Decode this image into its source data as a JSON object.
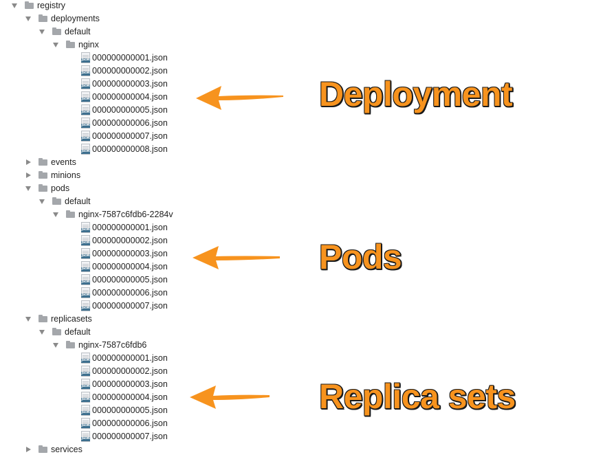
{
  "tree": [
    {
      "depth": 0,
      "type": "folder",
      "expanded": true,
      "label": "registry"
    },
    {
      "depth": 1,
      "type": "folder",
      "expanded": true,
      "label": "deployments"
    },
    {
      "depth": 2,
      "type": "folder",
      "expanded": true,
      "label": "default"
    },
    {
      "depth": 3,
      "type": "folder",
      "expanded": true,
      "label": "nginx"
    },
    {
      "depth": 4,
      "type": "file",
      "label": "000000000001.json"
    },
    {
      "depth": 4,
      "type": "file",
      "label": "000000000002.json"
    },
    {
      "depth": 4,
      "type": "file",
      "label": "000000000003.json"
    },
    {
      "depth": 4,
      "type": "file",
      "label": "000000000004.json"
    },
    {
      "depth": 4,
      "type": "file",
      "label": "000000000005.json"
    },
    {
      "depth": 4,
      "type": "file",
      "label": "000000000006.json"
    },
    {
      "depth": 4,
      "type": "file",
      "label": "000000000007.json"
    },
    {
      "depth": 4,
      "type": "file",
      "label": "000000000008.json"
    },
    {
      "depth": 1,
      "type": "folder",
      "expanded": false,
      "label": "events"
    },
    {
      "depth": 1,
      "type": "folder",
      "expanded": false,
      "label": "minions"
    },
    {
      "depth": 1,
      "type": "folder",
      "expanded": true,
      "label": "pods"
    },
    {
      "depth": 2,
      "type": "folder",
      "expanded": true,
      "label": "default"
    },
    {
      "depth": 3,
      "type": "folder",
      "expanded": true,
      "label": "nginx-7587c6fdb6-2284v"
    },
    {
      "depth": 4,
      "type": "file",
      "label": "000000000001.json"
    },
    {
      "depth": 4,
      "type": "file",
      "label": "000000000002.json"
    },
    {
      "depth": 4,
      "type": "file",
      "label": "000000000003.json"
    },
    {
      "depth": 4,
      "type": "file",
      "label": "000000000004.json"
    },
    {
      "depth": 4,
      "type": "file",
      "label": "000000000005.json"
    },
    {
      "depth": 4,
      "type": "file",
      "label": "000000000006.json"
    },
    {
      "depth": 4,
      "type": "file",
      "label": "000000000007.json"
    },
    {
      "depth": 1,
      "type": "folder",
      "expanded": true,
      "label": "replicasets"
    },
    {
      "depth": 2,
      "type": "folder",
      "expanded": true,
      "label": "default"
    },
    {
      "depth": 3,
      "type": "folder",
      "expanded": true,
      "label": "nginx-7587c6fdb6"
    },
    {
      "depth": 4,
      "type": "file",
      "label": "000000000001.json"
    },
    {
      "depth": 4,
      "type": "file",
      "label": "000000000002.json"
    },
    {
      "depth": 4,
      "type": "file",
      "label": "000000000003.json"
    },
    {
      "depth": 4,
      "type": "file",
      "label": "000000000004.json"
    },
    {
      "depth": 4,
      "type": "file",
      "label": "000000000005.json"
    },
    {
      "depth": 4,
      "type": "file",
      "label": "000000000006.json"
    },
    {
      "depth": 4,
      "type": "file",
      "label": "000000000007.json"
    },
    {
      "depth": 1,
      "type": "folder",
      "expanded": false,
      "label": "services"
    }
  ],
  "file_badge": "JSON",
  "annotations": {
    "deployment": "Deployment",
    "pods": "Pods",
    "replica_sets": "Replica sets"
  },
  "colors": {
    "annotation": "#f7931e",
    "annotation_outline": "#1a1a1a",
    "folder": "#a4a7ab",
    "json_badge": "#3d6f8e"
  }
}
